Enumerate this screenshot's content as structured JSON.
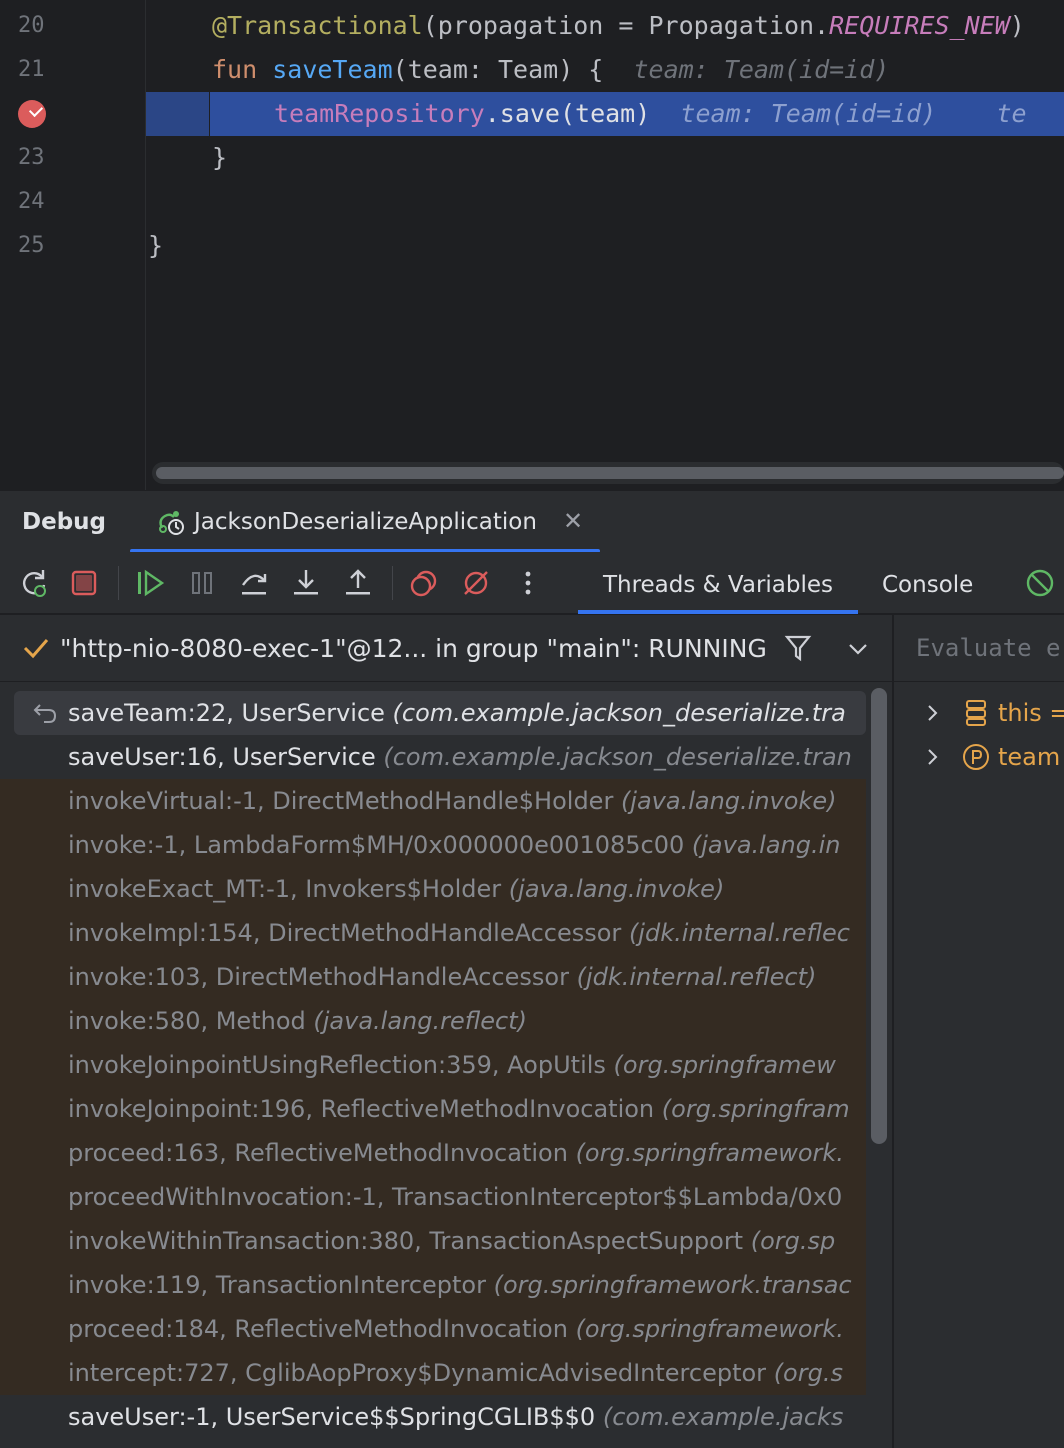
{
  "editor": {
    "line_numbers": [
      "20",
      "21",
      "23",
      "24",
      "25"
    ],
    "lines": {
      "l20": {
        "annotation": "@Transactional",
        "open": "(propagation = Propagation.",
        "constant": "REQUIRES_NEW",
        "close": ")"
      },
      "l21": {
        "keyword": "fun",
        "fname": "saveTeam",
        "params": "(team: Team) {",
        "hint": "team: Team(id=id)"
      },
      "l22": {
        "field": "teamRepository",
        "call": ".save(team)",
        "hint": "team: Team(id=id)",
        "hint2": "te"
      },
      "l23": {
        "text": "}"
      },
      "l25": {
        "text": "}"
      }
    }
  },
  "debug": {
    "title": "Debug",
    "run_config": "JacksonDeserializeApplication",
    "tabs": {
      "threads_variables": "Threads & Variables",
      "console": "Console"
    }
  },
  "thread": {
    "label": "\"http-nio-8080-exec-1\"@12... in group \"main\": RUNNING"
  },
  "frames": [
    {
      "method": "saveTeam:22, UserService ",
      "pkg": "(com.example.jackson_deserialize.tra",
      "kind": "sel"
    },
    {
      "method": "saveUser:16, UserService ",
      "pkg": "(com.example.jackson_deserialize.tran",
      "kind": "app"
    },
    {
      "method": "invokeVirtual:-1, DirectMethodHandle$Holder ",
      "pkg": "(java.lang.invoke)",
      "kind": "lib"
    },
    {
      "method": "invoke:-1, LambdaForm$MH/0x000000e001085c00 ",
      "pkg": "(java.lang.in",
      "kind": "lib"
    },
    {
      "method": "invokeExact_MT:-1, Invokers$Holder ",
      "pkg": "(java.lang.invoke)",
      "kind": "lib"
    },
    {
      "method": "invokeImpl:154, DirectMethodHandleAccessor ",
      "pkg": "(jdk.internal.reflec",
      "kind": "lib"
    },
    {
      "method": "invoke:103, DirectMethodHandleAccessor ",
      "pkg": "(jdk.internal.reflect)",
      "kind": "lib"
    },
    {
      "method": "invoke:580, Method ",
      "pkg": "(java.lang.reflect)",
      "kind": "lib"
    },
    {
      "method": "invokeJoinpointUsingReflection:359, AopUtils ",
      "pkg": "(org.springframew",
      "kind": "lib"
    },
    {
      "method": "invokeJoinpoint:196, ReflectiveMethodInvocation ",
      "pkg": "(org.springfram",
      "kind": "lib"
    },
    {
      "method": "proceed:163, ReflectiveMethodInvocation ",
      "pkg": "(org.springframework.",
      "kind": "lib"
    },
    {
      "method": "proceedWithInvocation:-1, TransactionInterceptor$$Lambda/0x0",
      "pkg": "",
      "kind": "lib"
    },
    {
      "method": "invokeWithinTransaction:380, TransactionAspectSupport ",
      "pkg": "(org.sp",
      "kind": "lib"
    },
    {
      "method": "invoke:119, TransactionInterceptor ",
      "pkg": "(org.springframework.transac",
      "kind": "lib"
    },
    {
      "method": "proceed:184, ReflectiveMethodInvocation ",
      "pkg": "(org.springframework.",
      "kind": "lib"
    },
    {
      "method": "intercept:727, CglibAopProxy$DynamicAdvisedInterceptor ",
      "pkg": "(org.s",
      "kind": "lib"
    },
    {
      "method": "saveUser:-1, UserService$$SpringCGLIB$$0 ",
      "pkg": "(com.example.jacks",
      "kind": "app"
    }
  ],
  "variables": {
    "evaluate_placeholder": "Evaluate e",
    "items": [
      {
        "name": "this =",
        "icon": "field-list-icon"
      },
      {
        "name": "team",
        "icon": "parameter-icon"
      }
    ]
  },
  "colors": {
    "accent": "#3574f0",
    "breakpoint": "#db5c5c",
    "library_frame_bg": "#342b22",
    "current_line_bg": "#2e4f9e"
  }
}
